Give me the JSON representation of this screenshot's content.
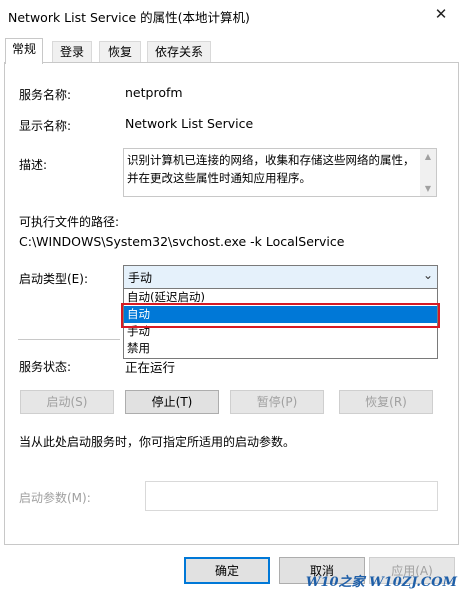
{
  "window": {
    "title": "Network List Service 的属性(本地计算机)",
    "close_glyph": "✕",
    "close_icon": "close-icon"
  },
  "tabs": [
    {
      "label": "常规",
      "active": true
    },
    {
      "label": "登录"
    },
    {
      "label": "恢复"
    },
    {
      "label": "依存关系"
    }
  ],
  "general": {
    "service_name_label": "服务名称:",
    "service_name": "netprofm",
    "display_name_label": "显示名称:",
    "display_name": "Network List Service",
    "description_label": "描述:",
    "description": "识别计算机已连接的网络，收集和存储这些网络的属性，并在更改这些属性时通知应用程序。",
    "scroll_up_glyph": "▲",
    "scroll_down_glyph": "▼",
    "path_label": "可执行文件的路径:",
    "path": "C:\\WINDOWS\\System32\\svchost.exe -k LocalService",
    "startup_type_label": "启动类型(E):",
    "startup_type_value": "手动",
    "chevron_glyph": "⌄",
    "startup_options": [
      "自动(延迟启动)",
      "自动",
      "手动",
      "禁用"
    ],
    "highlighted_option": "自动",
    "service_status_label": "服务状态:",
    "service_status": "正在运行",
    "buttons": {
      "start": "启动(S)",
      "stop": "停止(T)",
      "pause": "暂停(P)",
      "resume": "恢复(R)"
    },
    "hint": "当从此处启动服务时，你可指定所适用的启动参数。",
    "start_params_label": "启动参数(M):",
    "start_params_value": ""
  },
  "footer": {
    "ok": "确定",
    "cancel": "取消",
    "apply": "应用(A)"
  },
  "watermark": "W10之家 W10ZJ.COM",
  "colors": {
    "highlight": "#0078d7",
    "annotation_box": "#d71a24",
    "accent": "#0078d7"
  }
}
